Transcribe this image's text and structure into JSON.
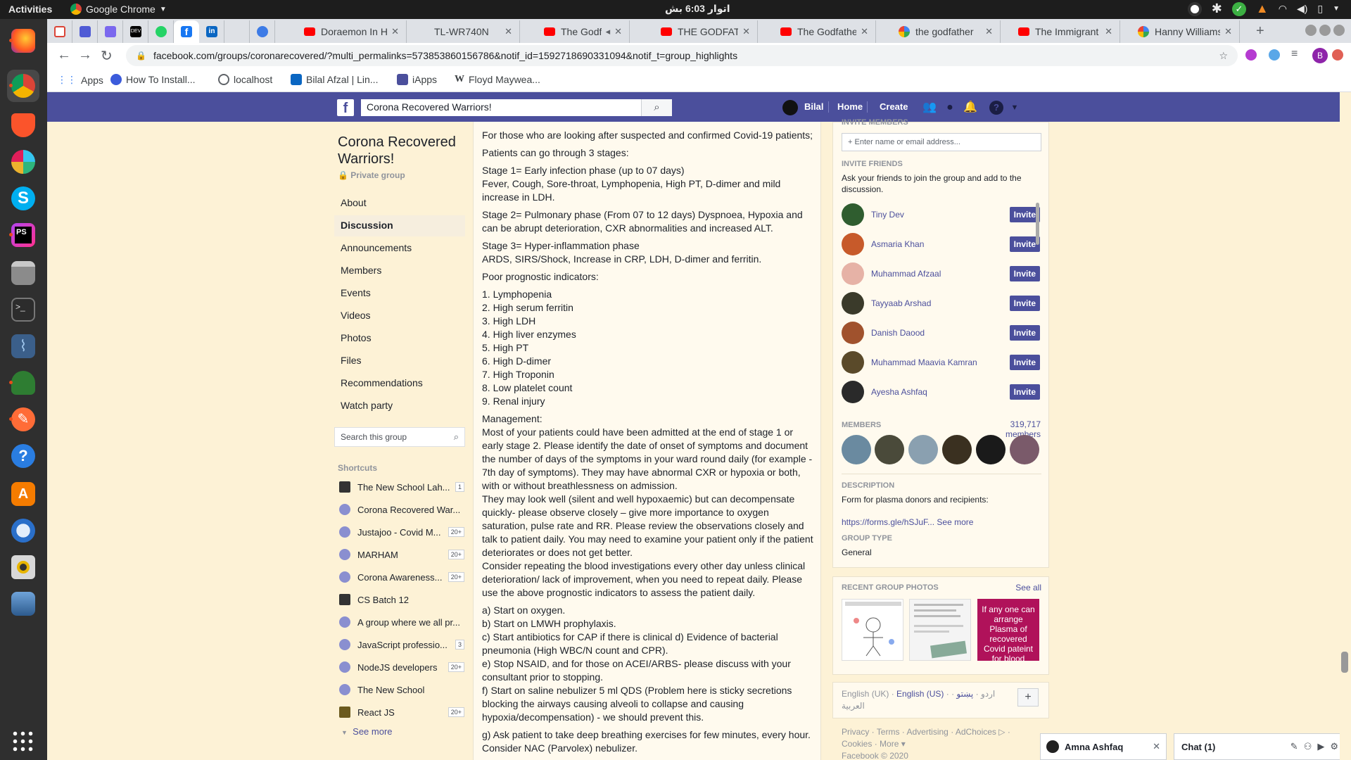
{
  "system": {
    "activities": "Activities",
    "app_name": "Google Chrome",
    "clock": "اتوار 6:03 بش"
  },
  "dock": {
    "items": [
      "firefox-icon",
      "chrome-icon",
      "brave-icon",
      "slack-icon",
      "skype-icon",
      "phpstorm-icon",
      "files-icon",
      "terminal-icon",
      "mysql-workbench-icon",
      "inkscape-icon",
      "postman-icon",
      "help-icon",
      "software-center-icon",
      "thunderbird-icon",
      "rhythmbox-icon",
      "screenshot-icon",
      "show-apps-icon"
    ]
  },
  "tabs": [
    {
      "label": ""
    },
    {
      "label": ""
    },
    {
      "label": ""
    },
    {
      "label": ""
    },
    {
      "label": ""
    },
    {
      "label": ""
    },
    {
      "label": ""
    },
    {
      "label": ""
    },
    {
      "label": ""
    },
    {
      "label": "Doraemon In H"
    },
    {
      "label": "TL-WR740N"
    },
    {
      "label": "The Godfath"
    },
    {
      "label": "THE GODFATH"
    },
    {
      "label": "The Godfather"
    },
    {
      "label": "the godfather"
    },
    {
      "label": "The Immigrant"
    },
    {
      "label": "Hanny Williams"
    }
  ],
  "url": "facebook.com/groups/coronarecovered/?multi_permalinks=573853860156786&notif_id=1592718690331094&notif_t=group_highlights",
  "bookmarks": [
    "Apps",
    "How To Install...",
    "localhost",
    "Bilal Afzal | Lin...",
    "iApps",
    "Floyd Maywea..."
  ],
  "fb": {
    "search_value": "Corona Recovered Warriors!",
    "user": "Bilal",
    "home": "Home",
    "create": "Create"
  },
  "group": {
    "name": "Corona Recovered Warriors!",
    "privacy": "Private group",
    "nav": [
      "About",
      "Discussion",
      "Announcements",
      "Members",
      "Events",
      "Videos",
      "Photos",
      "Files",
      "Recommendations",
      "Watch party"
    ],
    "search_placeholder": "Search this group",
    "shortcuts_title": "Shortcuts",
    "shortcuts": [
      {
        "label": "The New School Lah...",
        "badge": "1"
      },
      {
        "label": "Corona Recovered War...",
        "badge": ""
      },
      {
        "label": "Justajoo - Covid M...",
        "badge": "20+"
      },
      {
        "label": "MARHAM",
        "badge": "20+"
      },
      {
        "label": "Corona Awareness...",
        "badge": "20+"
      },
      {
        "label": "CS Batch 12",
        "badge": ""
      },
      {
        "label": "A group where we all pr...",
        "badge": ""
      },
      {
        "label": "JavaScript professio...",
        "badge": "3"
      },
      {
        "label": "NodeJS developers",
        "badge": "20+"
      },
      {
        "label": "The New School",
        "badge": ""
      },
      {
        "label": "React JS",
        "badge": "20+"
      }
    ],
    "see_more": "See more"
  },
  "post": {
    "lines": [
      "For those who are looking after suspected and confirmed Covid-19 patients;",
      "Patients can go through 3 stages:",
      "Stage 1= Early infection phase (up to 07 days)",
      "Fever, Cough, Sore-throat, Lymphopenia, High PT, D-dimer and mild",
      "increase in LDH.",
      "Stage 2= Pulmonary phase (From 07 to 12 days) Dyspnoea, Hypoxia and",
      "can be abrupt deterioration, CXR abnormalities and increased ALT.",
      "Stage 3= Hyper-inflammation phase",
      "ARDS, SIRS/Shock, Increase in CRP, LDH, D-dimer and ferritin.",
      "Poor prognostic indicators:",
      "1. Lymphopenia",
      "2. High serum ferritin",
      "3. High LDH",
      "4. High liver enzymes",
      "5. High PT",
      "6. High D-dimer",
      "7. High Troponin",
      "8. Low platelet count",
      "9. Renal injury",
      "Management:",
      "Most of your patients could have been admitted at the end of stage 1 or",
      "early stage 2. Please identify the date of onset of symptoms and document",
      "the number of days of the symptoms in your ward round daily (for example -",
      "7th day of symptoms). They may have abnormal CXR or hypoxia or both,",
      "with or without breathlessness on admission.",
      "They may look well (silent and well hypoxaemic) but can decompensate",
      "quickly- please observe closely – give more importance to oxygen",
      "saturation, pulse rate and RR. Please review the observations closely and",
      "talk to patient daily. You may need to examine your patient only if the patient",
      "deteriorates or does not get better.",
      "Consider repeating the blood investigations every other day unless clinical",
      "deterioration/ lack of improvement, when you need to repeat daily. Please",
      "use the above prognostic indicators to assess the patient daily.",
      "a) Start on oxygen.",
      "b) Start on LMWH prophylaxis.",
      "c) Start antibiotics for CAP if there is clinical d) Evidence of bacterial",
      "pneumonia (High WBC/N count and CPR).",
      "e) Stop NSAID, and for those on ACEI/ARBS- please discuss with your",
      "consultant prior to stopping.",
      "f) Start on saline nebulizer 5 ml QDS (Problem here is sticky secretions",
      "blocking the airways causing alveoli to collapse and causing",
      "hypoxia/decompensation) - we should prevent this.",
      "g) Ask patient to take deep breathing exercises for few minutes, every hour.",
      "Consider NAC (Parvolex) nebulizer."
    ]
  },
  "sidebar": {
    "invite_members_title": "INVITE MEMBERS",
    "invite_placeholder": "Enter name or email address...",
    "invite_friends_title": "INVITE FRIENDS",
    "invite_friends_text": "Ask your friends to join the group and add to the discussion.",
    "invite_label": "Invite",
    "friends": [
      "Tiny Dev",
      "Asmaria Khan",
      "Muhammad Afzaal",
      "Tayyaab Arshad",
      "Danish Daood",
      "Muhammad Maavia Kamran",
      "Ayesha Ashfaq"
    ],
    "members_title": "MEMBERS",
    "members_count": "319,717 members",
    "description_title": "DESCRIPTION",
    "description": "Form for plasma donors and recipients:",
    "description_link": "https://forms.gle/hSJuF...",
    "description_see_more": "See more",
    "group_type_title": "GROUP TYPE",
    "group_type": "General",
    "recent_photos_title": "RECENT GROUP PHOTOS",
    "see_all": "See all",
    "photo3_text": "If any one can arrange Plasma of recovered Covid pateint for blood",
    "languages": {
      "english_uk": "English (UK)",
      "english_us": "English (US)",
      "urdu": "اردو",
      "pashto": "پښتو",
      "arabic": "العربية"
    },
    "footer_links": [
      "Privacy",
      "Terms",
      "Advertising",
      "AdChoices",
      "Cookies",
      "More"
    ],
    "copyright": "Facebook © 2020"
  },
  "chat": {
    "open_chat": "Amna Ashfaq",
    "chat_label": "Chat (1)"
  }
}
